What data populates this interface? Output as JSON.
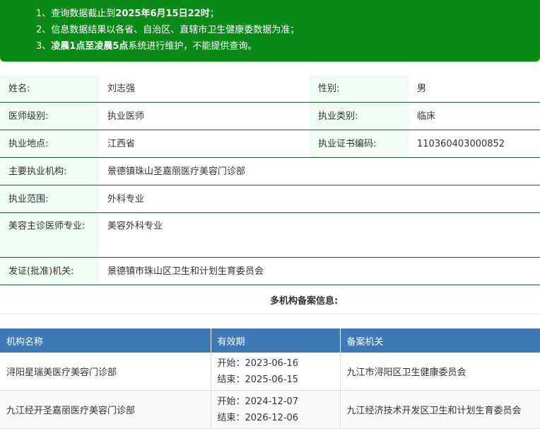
{
  "notice": {
    "line1_prefix": "1、查询数据截止到",
    "line1_bold": "2025年6月15日22时",
    "line1_suffix": "；",
    "line2": "2、信息数据结果以各省、自治区、直辖市卫生健康委数据为准；",
    "line3_prefix": "3、",
    "line3_bold": "凌晨1点至凌晨5点",
    "line3_suffix": "系统进行维护，不能提供查询。"
  },
  "profile": {
    "name_label": "姓名:",
    "name_value": "刘志强",
    "gender_label": "性别:",
    "gender_value": "男",
    "level_label": "医师级别:",
    "level_value": "执业医师",
    "category_label": "执业类别:",
    "category_value": "临床",
    "location_label": "执业地点:",
    "location_value": "江西省",
    "cert_label": "执业证书编码:",
    "cert_value": "110360403000852",
    "institution_label": "主要执业机构:",
    "institution_value": "景德镇珠山圣嘉丽医疗美容门诊部",
    "scope_label": "执业范围:",
    "scope_value": "外科专业",
    "cosmetic_label": "美容主诊医师专业:",
    "cosmetic_value": "美容外科专业",
    "issuer_label": "发证(批准)机关:",
    "issuer_value": "景德镇市珠山区卫生和计划生育委员会"
  },
  "multi": {
    "title": "多机构备案信息:",
    "headers": [
      "机构名称",
      "有效期",
      "备案机关"
    ],
    "rows": [
      {
        "institution": "浔阳星瑞美医疗美容门诊部",
        "start": "开始：2023-06-16",
        "end": "结束：2025-06-15",
        "authority": "九江市浔阳区卫生健康委员会"
      },
      {
        "institution": "九江经开圣嘉丽医疗美容门诊部",
        "start": "开始：2024-12-07",
        "end": "结束：2026-12-06",
        "authority": "九江经济技术开发区卫生和计划生育委员会"
      }
    ]
  },
  "colors": {
    "notice_bg": "#0a8a16",
    "label_bg": "#f0fbf4",
    "table_header_bg": "#3d7ab7",
    "row_border": "#1f5b3a"
  }
}
